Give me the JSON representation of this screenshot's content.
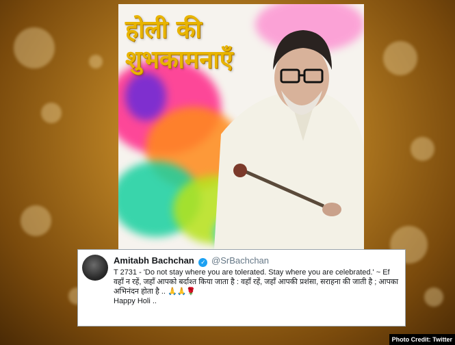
{
  "poster": {
    "title_line1": "होली की",
    "title_line2": "शुभकामनाएँ"
  },
  "tweet": {
    "author_name": "Amitabh Bachchan",
    "verified_icon": "verified-badge-icon",
    "handle": "@SrBachchan",
    "text_english": "T 2731 - 'Do not stay where you are tolerated. Stay where you are celebrated.' ~ Ef",
    "text_hindi": "वहाँ न रहें, जहाँ आपको बर्दाश्त किया जाता है  :  वहाँ रहें, जहाँ आपकी प्रशंसा, सराहना की जाती है ; आपका अभिनंदन होता है  ..",
    "emoji": "🙏🙏🌹",
    "sign_off": "Happy Holi .."
  },
  "photo_credit": "Photo Credit: Twitter",
  "colors": {
    "background": "#b57d22",
    "title": "#e8b400",
    "verified": "#1da1f2",
    "handle": "#657786"
  }
}
